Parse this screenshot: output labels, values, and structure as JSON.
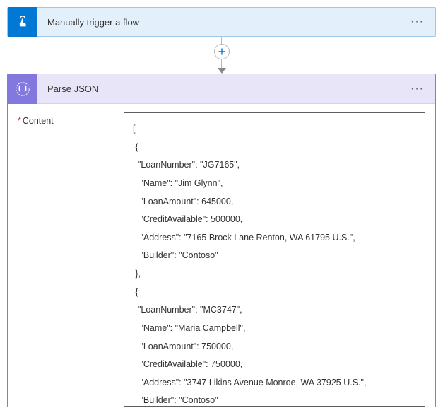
{
  "trigger": {
    "title": "Manually trigger a flow",
    "icon_name": "hand-tap-icon"
  },
  "action": {
    "title": "Parse JSON",
    "icon_name": "braces-icon",
    "field_label": "Content",
    "required_marker": "*",
    "content_text": "[\n {\n  \"LoanNumber\": \"JG7165\",\n   \"Name\": \"Jim Glynn\",\n   \"LoanAmount\": 645000,\n   \"CreditAvailable\": 500000,\n   \"Address\": \"7165 Brock Lane Renton, WA 61795 U.S.\",\n   \"Builder\": \"Contoso\"\n },\n {\n  \"LoanNumber\": \"MC3747\",\n   \"Name\": \"Maria Campbell\",\n   \"LoanAmount\": 750000,\n   \"CreditAvailable\": 750000,\n   \"Address\": \"3747 Likins Avenue Monroe, WA 37925 U.S.\",\n   \"Builder\": \"Contoso\"\n },\n {"
  },
  "colors": {
    "trigger_accent": "#0078d4",
    "trigger_bg": "#e3f0fb",
    "action_accent": "#8378de",
    "action_bg": "#e9e5f8"
  }
}
